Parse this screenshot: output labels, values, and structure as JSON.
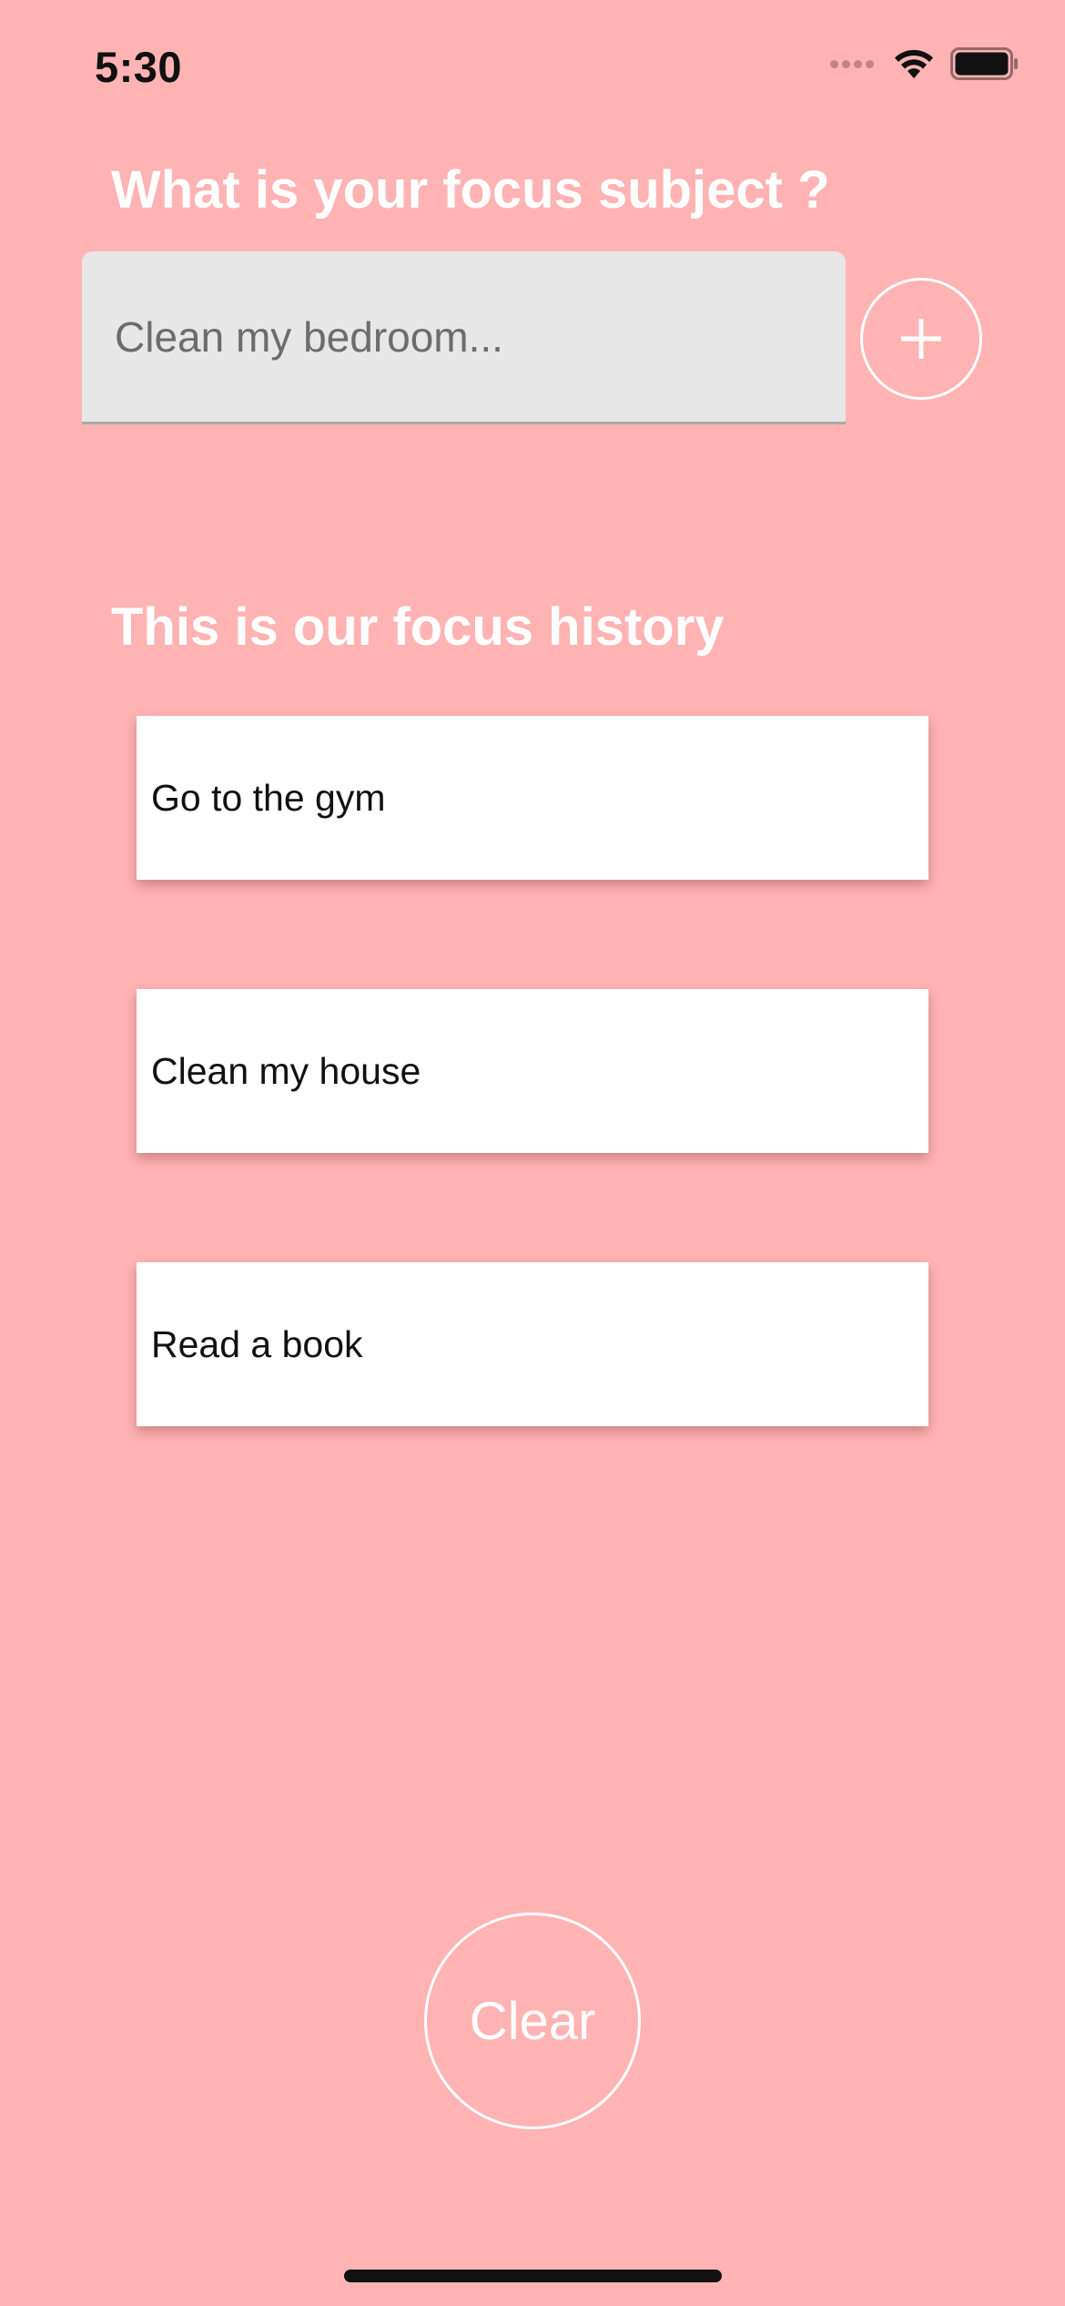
{
  "status_bar": {
    "time": "5:30",
    "icons": [
      "cellular-signal-icon",
      "wifi-icon",
      "battery-icon"
    ]
  },
  "focus": {
    "heading": "What is your focus subject ?",
    "input_placeholder": "Clean my bedroom...",
    "input_value": "",
    "add_button_icon": "plus-icon"
  },
  "history": {
    "heading": "This is our focus history",
    "items": [
      {
        "label": "Go to the gym"
      },
      {
        "label": "Clean my house"
      },
      {
        "label": "Read a book"
      }
    ]
  },
  "clear_button_label": "Clear",
  "colors": {
    "background": "#ffb3b3",
    "text_on_background": "#ffffff",
    "input_background": "#e7e7e7",
    "card_background": "#ffffff"
  }
}
